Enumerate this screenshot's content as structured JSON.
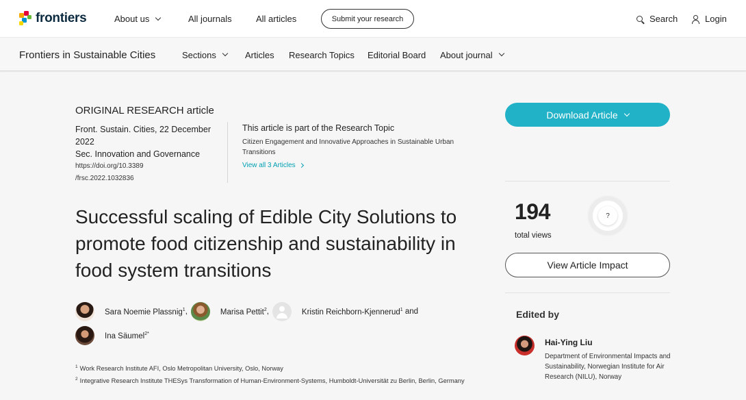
{
  "header": {
    "logo_text": "frontiers",
    "nav": [
      {
        "label": "About us",
        "has_dropdown": true
      },
      {
        "label": "All journals",
        "has_dropdown": false
      },
      {
        "label": "All articles",
        "has_dropdown": false
      }
    ],
    "submit_label": "Submit your research",
    "search_label": "Search",
    "login_label": "Login"
  },
  "journal_bar": {
    "title": "Frontiers in Sustainable Cities",
    "items": [
      {
        "label": "Sections",
        "has_dropdown": true
      },
      {
        "label": "Articles",
        "has_dropdown": false
      },
      {
        "label": "Research Topics",
        "has_dropdown": false
      },
      {
        "label": "Editorial Board",
        "has_dropdown": false
      },
      {
        "label": "About journal",
        "has_dropdown": true
      }
    ]
  },
  "article": {
    "type": "ORIGINAL RESEARCH article",
    "journal_date": "Front. Sustain. Cities, 22 December 2022",
    "section": "Sec. Innovation and Governance",
    "doi_line1": "https://doi.org/10.3389",
    "doi_line2": "/frsc.2022.1032836",
    "research_topic_heading": "This article is part of the Research Topic",
    "research_topic_name": "Citizen Engagement and Innovative Approaches in Sustainable Urban Transitions",
    "view_all_label": "View all 3 Articles",
    "title": "Successful scaling of Edible City Solutions to promote food citizenship and sustainability in food system transitions",
    "authors": [
      {
        "name": "Sara Noemie Plassnig",
        "sup": "1",
        "sep": ","
      },
      {
        "name": "Marisa Pettit",
        "sup": "2",
        "sep": ","
      },
      {
        "name": "Kristin Reichborn-Kjennerud",
        "sup": "1",
        "sep": " and"
      },
      {
        "name": "Ina Säumel",
        "sup": "2*",
        "sep": ""
      }
    ],
    "affiliations": [
      {
        "num": "1",
        "text": "Work Research Institute AFI, Oslo Metropolitan University, Oslo, Norway"
      },
      {
        "num": "2",
        "text": "Integrative Research Institute THESys Transformation of Human-Environment-Systems, Humboldt-Universität zu Berlin, Berlin, Germany"
      }
    ]
  },
  "sidebar": {
    "download_label": "Download Article",
    "views_count": "194",
    "views_label": "total views",
    "help_symbol": "?",
    "impact_label": "View Article Impact",
    "edited_by_label": "Edited by",
    "editor": {
      "name": "Hai-Ying Liu",
      "affiliation": "Department of Environmental Impacts and Sustainability, Norwegian Institute for Air Research (NILU), Norway"
    }
  },
  "colors": {
    "accent": "#22b2c7",
    "link": "#00a0b3",
    "logo_dark": "#0c2a3f"
  }
}
